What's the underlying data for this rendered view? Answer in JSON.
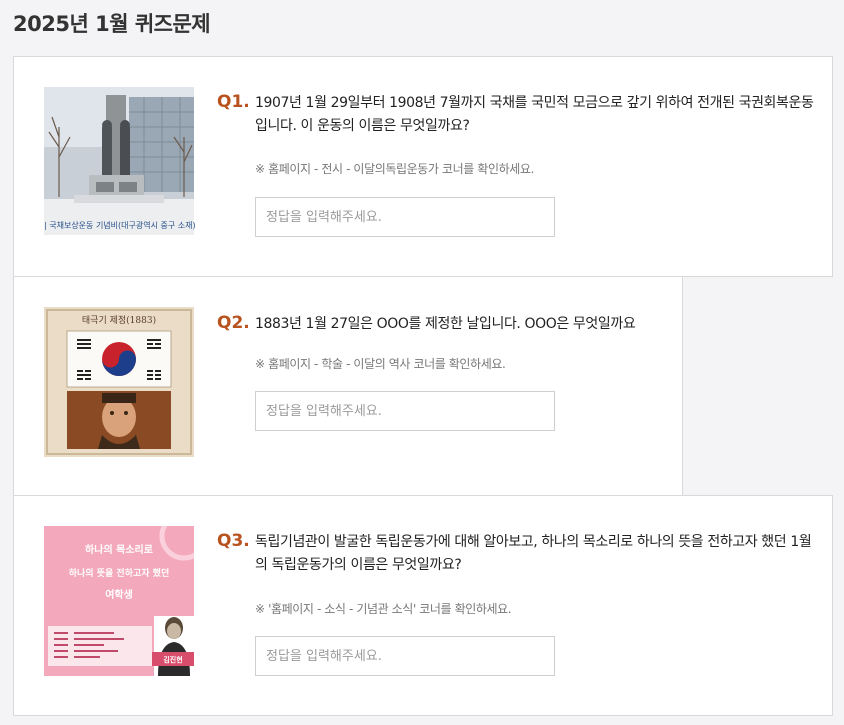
{
  "page": {
    "title": "2025년 1월 퀴즈문제"
  },
  "questions": [
    {
      "label": "Q1.",
      "text": "1907년 1월 29일부터 1908년 7월까지 국채를 국민적 모금으로 갚기 위하여 전개된 국권회복운동입니다. 이 운동의 이름은 무엇일까요?",
      "hint": "※ 홈페이지 - 전시 - 이달의독립운동가 코너를 확인하세요.",
      "answer_placeholder": "정답을 입력해주세요.",
      "answer_value": "",
      "image_caption": "| 국채보상운동 기념비(대구광역시 중구 소재)"
    },
    {
      "label": "Q2.",
      "text": "1883년 1월 27일은 OOO를 제정한 날입니다. OOO은 무엇일까요",
      "hint": "※ 홈페이지 - 학술 - 이달의 역사 코너를 확인하세요.",
      "answer_placeholder": "정답을 입력해주세요.",
      "answer_value": "",
      "image_title": "태극기 제정(1883)"
    },
    {
      "label": "Q3.",
      "text": "독립기념관이 발굴한 독립운동가에 대해 알아보고, 하나의 목소리로 하나의 뜻을 전하고자 했던 1월의 독립운동가의 이름은 무엇일까요?",
      "hint": "※ '홈페이지 - 소식 - 기념관 소식' 코너를 확인하세요.",
      "answer_placeholder": "정답을 입력해주세요.",
      "answer_value": "",
      "image_title_lines": [
        "하나의 목소리로",
        "하나의 뜻을 전하고자 했던",
        "여학생"
      ],
      "image_name": "김진현"
    }
  ],
  "colors": {
    "background": "#f4f4f6",
    "card": "#ffffff",
    "border": "#d9d9d9",
    "question_label": "#b8531f",
    "hint": "#777777",
    "placeholder": "#9a9a9a"
  }
}
